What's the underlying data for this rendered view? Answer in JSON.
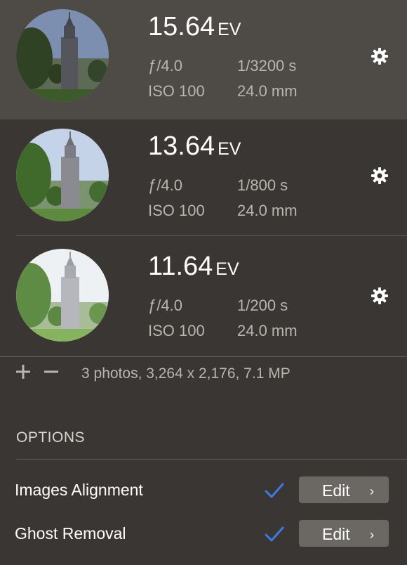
{
  "photos": [
    {
      "ev": "15.64",
      "ev_unit": "EV",
      "aperture": "ƒ/4.0",
      "shutter": "1/3200 s",
      "iso": "ISO 100",
      "focal": "24.0 mm",
      "selected": true
    },
    {
      "ev": "13.64",
      "ev_unit": "EV",
      "aperture": "ƒ/4.0",
      "shutter": "1/800 s",
      "iso": "ISO 100",
      "focal": "24.0 mm",
      "selected": false
    },
    {
      "ev": "11.64",
      "ev_unit": "EV",
      "aperture": "ƒ/4.0",
      "shutter": "1/200 s",
      "iso": "ISO 100",
      "focal": "24.0 mm",
      "selected": false
    }
  ],
  "summary": "3 photos, 3,264 x 2,176, 7.1 MP",
  "options": {
    "title": "OPTIONS",
    "items": [
      {
        "label": "Images Alignment",
        "checked": true,
        "edit_label": "Edit"
      },
      {
        "label": "Ghost Removal",
        "checked": true,
        "edit_label": "Edit"
      }
    ]
  },
  "colors": {
    "check": "#3d7be0",
    "selected_bg": "#4e4b47",
    "panel_bg": "#3a3633"
  },
  "icons": {
    "settings": "gear-icon",
    "add": "plus-icon",
    "remove": "minus-icon",
    "checked": "checkmark-icon",
    "chevron": "chevron-right-icon"
  }
}
